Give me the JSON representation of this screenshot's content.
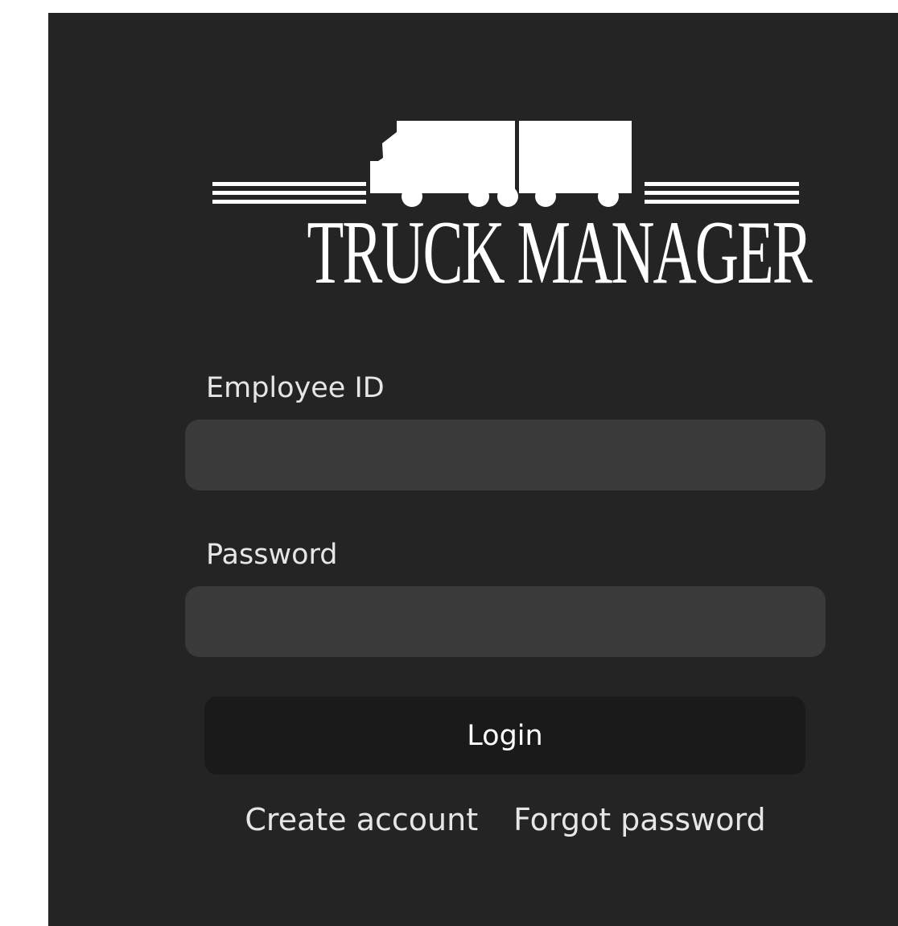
{
  "logo": {
    "icon": "truck-icon",
    "text": "TRUCK MANAGER"
  },
  "form": {
    "employee_id": {
      "label": "Employee ID",
      "value": "",
      "placeholder": ""
    },
    "password": {
      "label": "Password",
      "value": "",
      "placeholder": ""
    },
    "login_label": "Login"
  },
  "links": {
    "create_account": "Create account",
    "forgot_password": "Forgot password"
  },
  "colors": {
    "panel_background": "#242424",
    "input_background": "#3a3a3a",
    "button_background": "#1a1a1a",
    "text": "#e6e6e6",
    "logo": "#ffffff"
  }
}
